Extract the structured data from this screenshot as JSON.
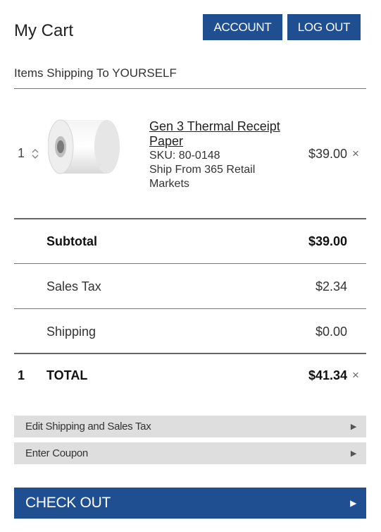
{
  "header": {
    "title": "My Cart",
    "account_label": "ACCOUNT",
    "logout_label": "LOG OUT"
  },
  "shipping_to": "Items Shipping To YOURSELF",
  "cart_item": {
    "quantity": "1",
    "name": "Gen 3 Thermal Receipt Paper",
    "sku": "SKU: 80-0148",
    "ship_from": "Ship From 365 Retail Markets",
    "price": "$39.00",
    "remove_label": "×"
  },
  "summary": {
    "subtotal_label": "Subtotal",
    "subtotal_value": "$39.00",
    "tax_label": "Sales Tax",
    "tax_value": "$2.34",
    "shipping_label": "Shipping",
    "shipping_value": "$0.00",
    "total_count": "1",
    "total_label": "TOTAL",
    "total_value": "$41.34",
    "total_remove_label": "×"
  },
  "accordions": {
    "edit_shipping_label": "Edit Shipping and Sales Tax",
    "coupon_label": "Enter Coupon",
    "arrow": "▶"
  },
  "checkout": {
    "label": "CHECK OUT",
    "arrow": "▶"
  },
  "colors": {
    "primary": "#1f4f91",
    "accordion_bg": "#dedede"
  },
  "icons": {
    "stepper": "chevron-up-down-icon",
    "remove": "close-icon",
    "arrow": "arrow-right-icon"
  }
}
